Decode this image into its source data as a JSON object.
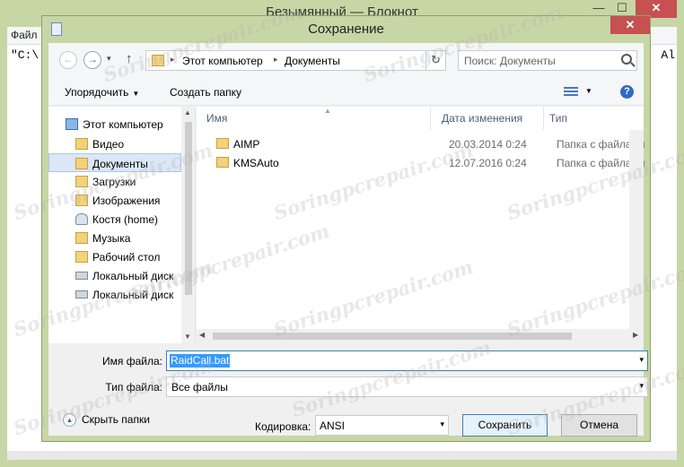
{
  "notepad": {
    "title": "Безымянный — Блокнот",
    "menu_file": "Файл",
    "text_left": "\"C:\\",
    "text_right": "Al",
    "min_glyph": "—",
    "max_glyph": "☐",
    "close_glyph": "✕"
  },
  "dialog": {
    "title": "Сохранение",
    "close_glyph": "✕",
    "nav": {
      "back_glyph": "←",
      "forward_glyph": "→",
      "dropdown_glyph": "▾",
      "up_glyph": "↑",
      "breadcrumb": [
        "Этот компьютер",
        "Документы"
      ],
      "breadcrumb_sep": "▸",
      "refresh_glyph": "↻",
      "search_placeholder": "Поиск: Документы"
    },
    "toolbar": {
      "organize": "Упорядочить",
      "new_folder": "Создать папку",
      "dropdown_glyph": "▼",
      "help": "?"
    },
    "nav_pane": {
      "items": [
        {
          "label": "Этот компьютер",
          "icon": "computer-icon"
        },
        {
          "label": "Видео",
          "icon": "folder-icon"
        },
        {
          "label": "Документы",
          "icon": "folder-icon",
          "selected": true
        },
        {
          "label": "Загрузки",
          "icon": "folder-icon"
        },
        {
          "label": "Изображения",
          "icon": "folder-icon"
        },
        {
          "label": "Костя (home)",
          "icon": "user-icon"
        },
        {
          "label": "Музыка",
          "icon": "folder-icon"
        },
        {
          "label": "Рабочий стол",
          "icon": "folder-icon"
        },
        {
          "label": "Локальный диск",
          "icon": "drive-icon"
        },
        {
          "label": "Локальный диск",
          "icon": "drive-icon"
        }
      ],
      "scroll_up": "▲",
      "scroll_down": "▼"
    },
    "file_list": {
      "columns": {
        "name": "Имя",
        "date": "Дата изменения",
        "type": "Тип"
      },
      "sort_glyph": "▲",
      "rows": [
        {
          "name": "AIMP",
          "date": "20.03.2014 0:24",
          "type": "Папка с файлами"
        },
        {
          "name": "KMSAuto",
          "date": "12.07.2016 0:24",
          "type": "Папка с файлами"
        }
      ],
      "scroll_left": "◀",
      "scroll_right": "▶"
    },
    "form": {
      "filename_label": "Имя файла:",
      "filename_value": "RaidCall.bat",
      "filetype_label": "Тип файла:",
      "filetype_value": "Все файлы",
      "hide_folders": "Скрыть папки",
      "hide_glyph": "▲",
      "encoding_label": "Кодировка:",
      "encoding_value": "ANSI",
      "save_button": "Сохранить",
      "cancel_button": "Отмена",
      "dropdown_glyph": "▾"
    }
  },
  "watermark": "Soringpcrepair.com",
  "colors": {
    "titlebar": "#c7d6a5",
    "close": "#c75050",
    "selection": "#3399ff",
    "accent_border": "#3c7fb1"
  }
}
